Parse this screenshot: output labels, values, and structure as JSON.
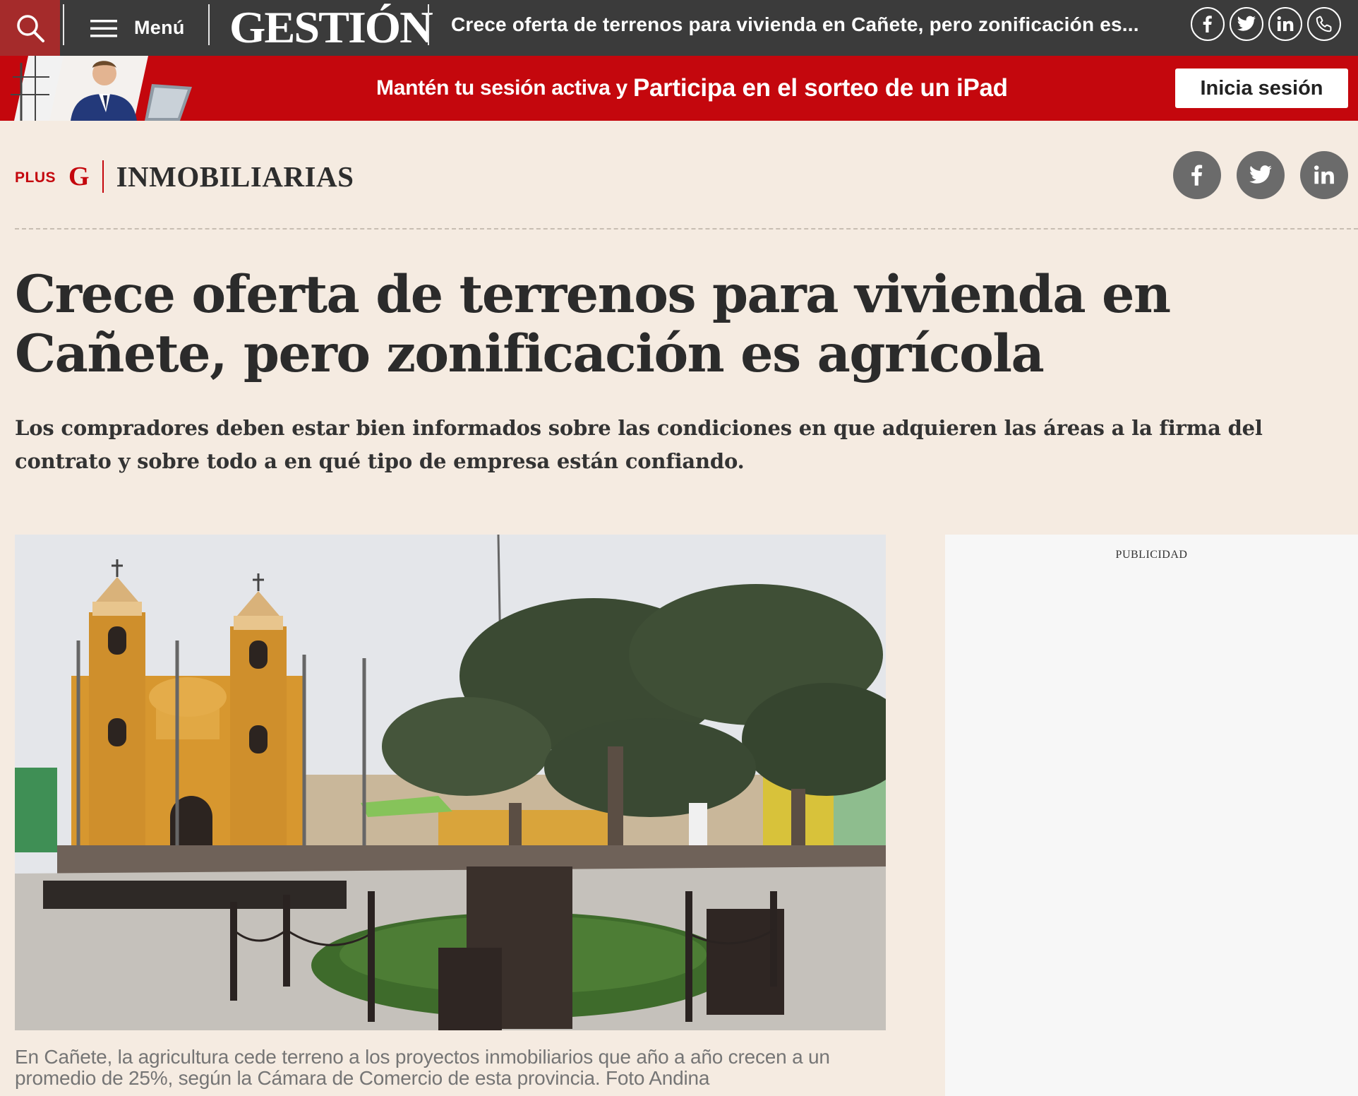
{
  "header": {
    "menu_label": "Menú",
    "logo_text": "GESTIÓN",
    "article_headline": "Crece oferta de terrenos para vivienda en Cañete, pero zonificación es..."
  },
  "promo": {
    "text_part1": "Mantén tu sesión activa y",
    "text_part2": "Participa en el sorteo de un iPad",
    "login_label": "Inicia sesión"
  },
  "section": {
    "plus_label": "PLUS",
    "g_label": "G",
    "name": "INMOBILIARIAS"
  },
  "article": {
    "title": "Crece oferta de terrenos para vivienda en Cañete, pero zonificación es agrícola",
    "subtitle": "Los compradores deben estar bien informados sobre las condiciones en que adquieren las áreas a la firma del contrato y sobre todo a en qué tipo de empresa están confiando.",
    "caption": "En Cañete, la agricultura cede terreno a los proyectos inmobiliarios que año a año crecen a un promedio de 25%, según la Cámara de Comercio de esta provincia. Foto Andina"
  },
  "ad": {
    "label": "PUBLICIDAD"
  },
  "icons": {
    "search": "search-icon",
    "menu": "hamburger-icon",
    "facebook": "facebook-icon",
    "twitter": "twitter-icon",
    "linkedin": "linkedin-icon",
    "whatsapp": "phone-icon"
  },
  "colors": {
    "topbar": "#3b3b3b",
    "search_bg": "#a52b2b",
    "brand_red": "#c4070d",
    "page_bg": "#f5ebe1",
    "share_gray": "#6b6b6b"
  }
}
